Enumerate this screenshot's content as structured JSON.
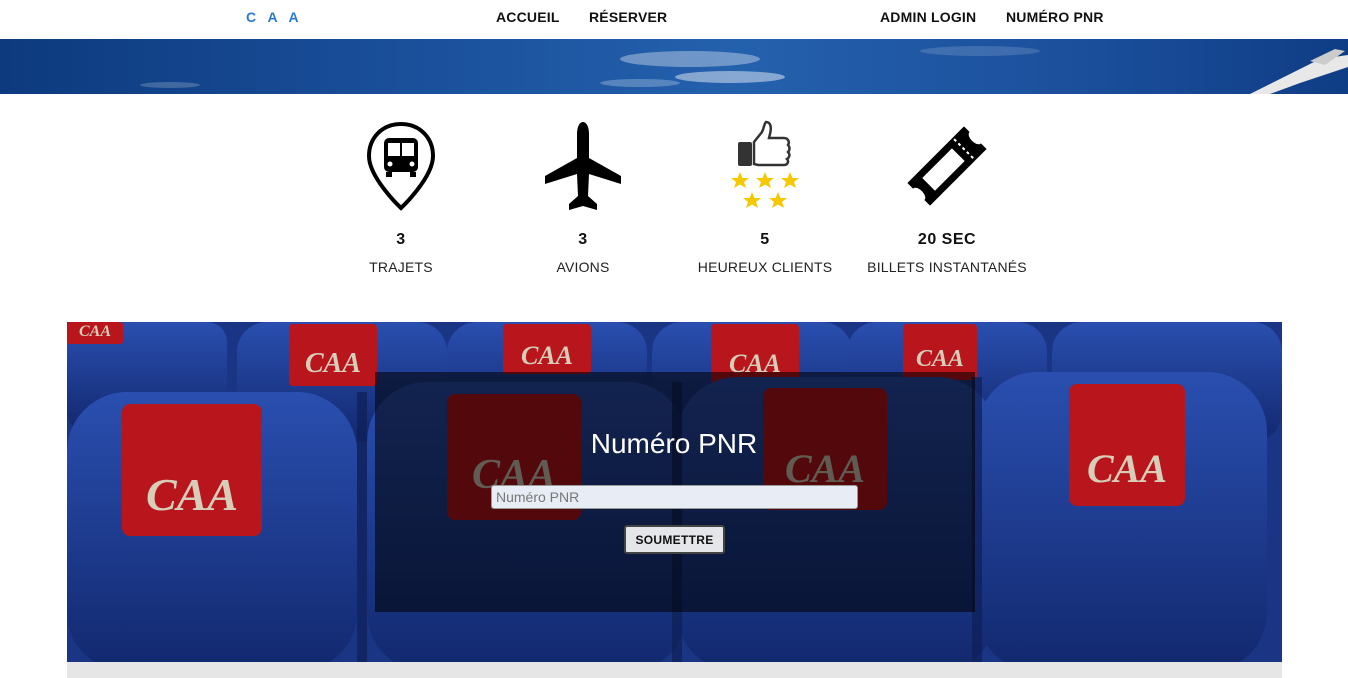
{
  "nav": {
    "brand": "C A A",
    "items": [
      {
        "label": "ACCUEIL"
      },
      {
        "label": "RÉSERVER"
      },
      {
        "label": "ADMIN LOGIN"
      },
      {
        "label": "NUMÉRO PNR"
      }
    ]
  },
  "stats": [
    {
      "icon": "bus-location-icon",
      "value": "3",
      "label": "TRAJETS"
    },
    {
      "icon": "airplane-icon",
      "value": "3",
      "label": "AVIONS"
    },
    {
      "icon": "thumbs-up-stars-icon",
      "value": "5",
      "label": "HEUREUX CLIENTS"
    },
    {
      "icon": "ticket-icon",
      "value": "20 SEC",
      "label": "BILLETS INSTANTANÉS"
    }
  ],
  "hero": {
    "seat_logo": "CAA",
    "title": "Numéro PNR",
    "input_placeholder": "Numéro PNR",
    "input_value": "",
    "submit_label": "SOUMETTRE"
  },
  "colors": {
    "brand": "#2a7ad2",
    "seat_blue": "#1d3f9e",
    "headrest_red": "#b8151c"
  }
}
